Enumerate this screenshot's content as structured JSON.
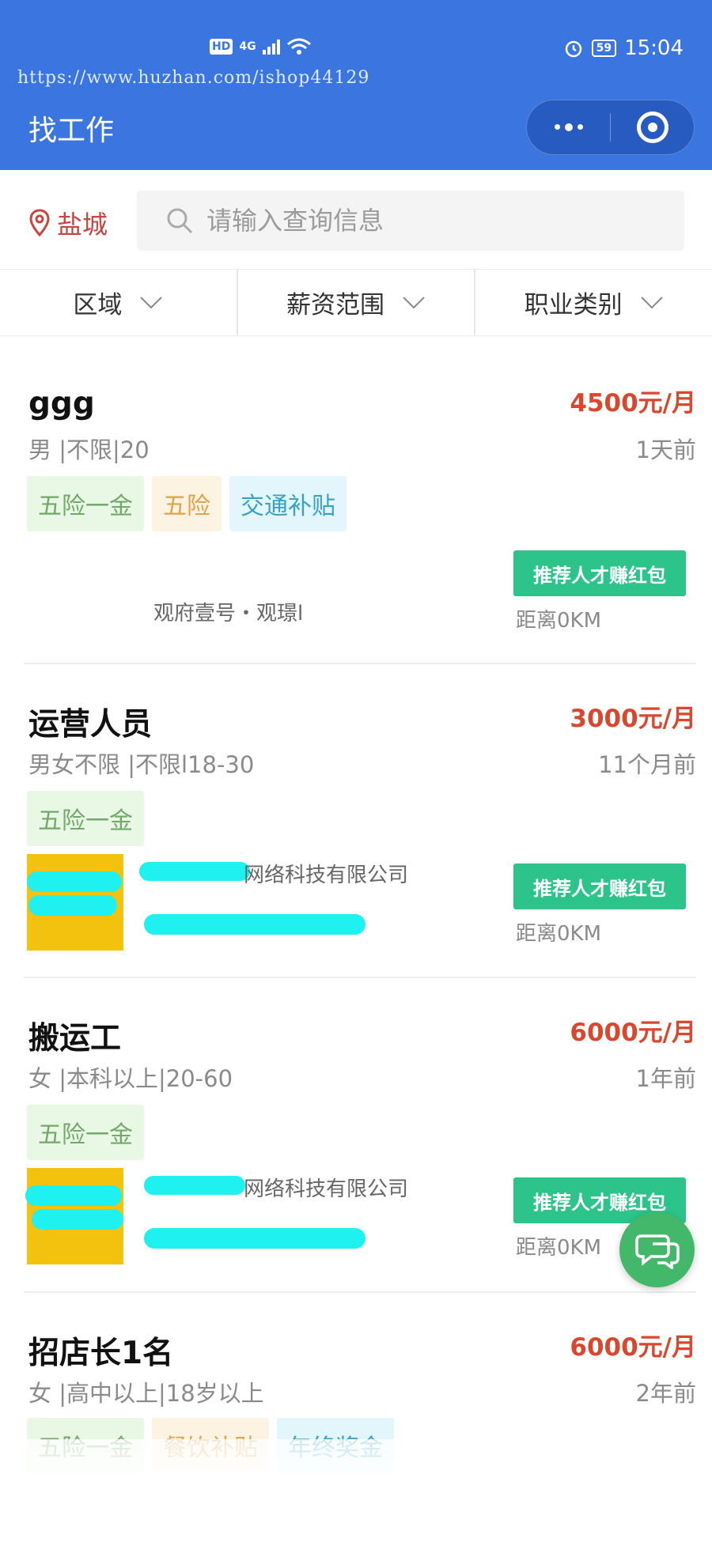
{
  "status_bar": {
    "network": "4G",
    "hd": "HD",
    "battery": "59",
    "time": "15:04"
  },
  "watermark_url": "https://www.huzhan.com/ishop44129",
  "header": {
    "title": "找工作"
  },
  "location": {
    "city": "盐城"
  },
  "search": {
    "placeholder": "请输入查询信息"
  },
  "filters": [
    {
      "label": "区域"
    },
    {
      "label": "薪资范围"
    },
    {
      "label": "职业类别"
    }
  ],
  "jobs": [
    {
      "title": "ggg",
      "salary": "4500元/月",
      "requirements": "男 |不限|20",
      "posted": "1天前",
      "tags": [
        "五险一金",
        "五险",
        "交通补贴"
      ],
      "company": "观府壹号・观璟l",
      "recommend": "推荐人才赚红包",
      "distance": "距离0KM"
    },
    {
      "title": "运营人员",
      "salary": "3000元/月",
      "requirements": "男女不限 |不限l18-30",
      "posted": "11个月前",
      "tags": [
        "五险一金"
      ],
      "company": "网络科技有限公司",
      "recommend": "推荐人才赚红包",
      "distance": "距离0KM"
    },
    {
      "title": "搬运工",
      "salary": "6000元/月",
      "requirements": "女 |本科以上|20-60",
      "posted": "1年前",
      "tags": [
        "五险一金"
      ],
      "company": "网络科技有限公司",
      "recommend": "推荐人才赚红包",
      "distance": "距离0KM"
    },
    {
      "title": "招店长1名",
      "salary": "6000元/月",
      "requirements": "女 |高中以上|18岁以上",
      "posted": "2年前",
      "tags": [
        "五险一金",
        "餐饮补贴",
        "年终奖金"
      ]
    }
  ],
  "colors": {
    "header_bg": "#3a75e0",
    "salary": "#d9472e",
    "recommend_bg": "#2cc48a",
    "chat_fab": "#44b86a"
  }
}
